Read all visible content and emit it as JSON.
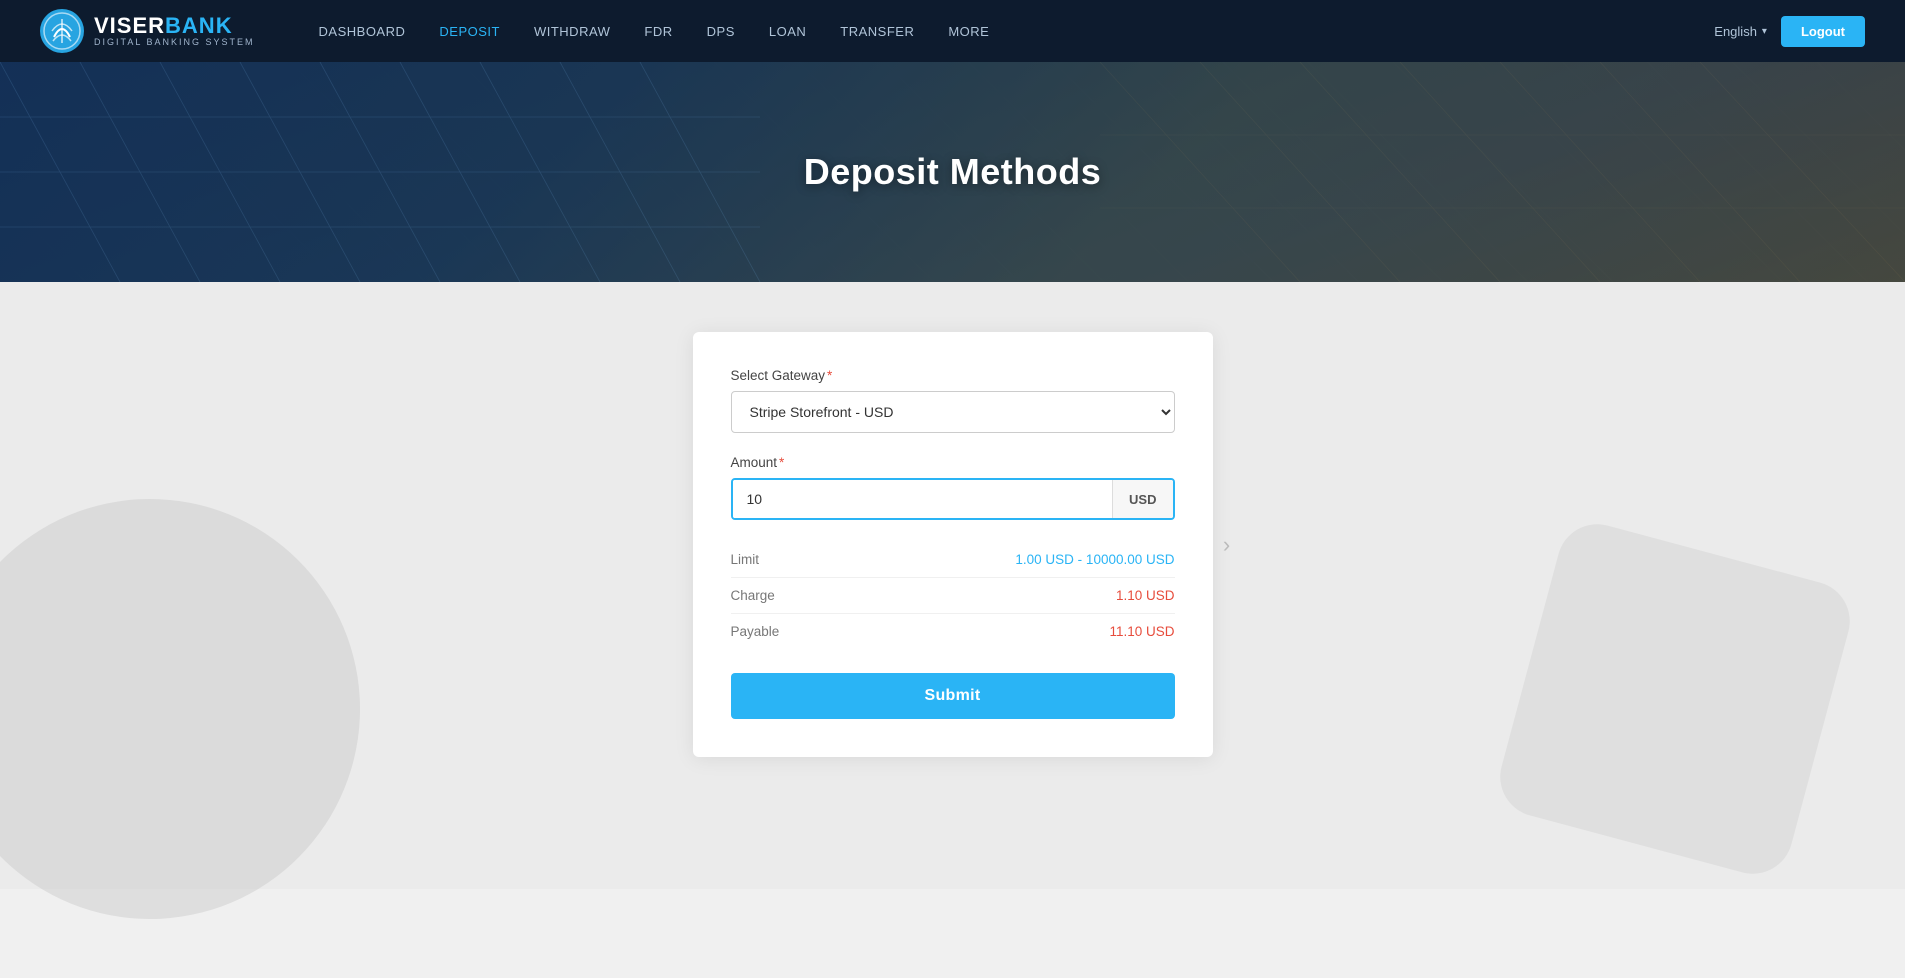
{
  "navbar": {
    "brand_name_viser": "VISER",
    "brand_name_bank": "BANK",
    "brand_sub": "Digital Banking System",
    "links": [
      {
        "id": "dashboard",
        "label": "DASHBOARD",
        "active": false
      },
      {
        "id": "deposit",
        "label": "DEPOSIT",
        "active": true
      },
      {
        "id": "withdraw",
        "label": "WITHDRAW",
        "active": false
      },
      {
        "id": "fdr",
        "label": "FDR",
        "active": false
      },
      {
        "id": "dps",
        "label": "DPS",
        "active": false
      },
      {
        "id": "loan",
        "label": "LOAN",
        "active": false
      },
      {
        "id": "transfer",
        "label": "TRANSFER",
        "active": false
      },
      {
        "id": "more",
        "label": "MORE",
        "active": false
      }
    ],
    "language": "English",
    "logout_label": "Logout"
  },
  "hero": {
    "title": "Deposit Methods"
  },
  "form": {
    "gateway_label": "Select Gateway",
    "gateway_option": "Stripe Storefront - USD",
    "amount_label": "Amount",
    "amount_value": "10",
    "amount_currency": "USD",
    "limit_label": "Limit",
    "limit_value": "1.00 USD - 10000.00 USD",
    "charge_label": "Charge",
    "charge_value": "1.10 USD",
    "payable_label": "Payable",
    "payable_value": "11.10 USD",
    "submit_label": "Submit"
  }
}
